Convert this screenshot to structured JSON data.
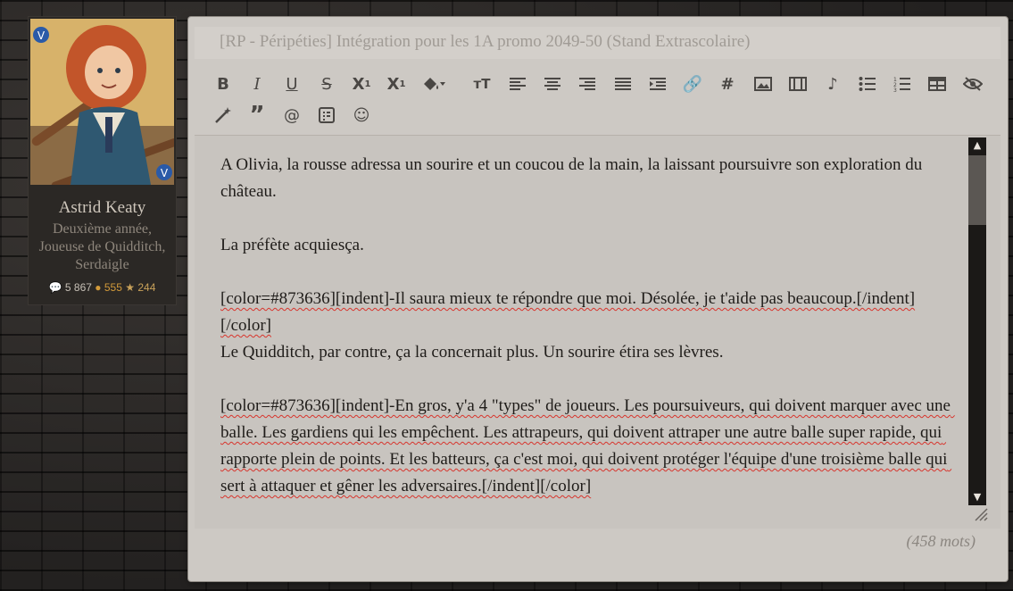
{
  "profile": {
    "name": "Astrid Keaty",
    "role": "Deuxième année, Joueuse de Quidditch, Serdaigle",
    "messages_count": "5 867",
    "gold_count": "555",
    "stars_count": "244",
    "avatar_icon": "character-portrait"
  },
  "editor": {
    "subject": "[RP - Péripéties] Intégration pour les 1A promo 2049-50 (Stand Extrascolaire)",
    "toolbar_row1": [
      "bold-icon",
      "italic-icon",
      "underline-icon",
      "strikethrough-icon",
      "subscript-icon",
      "superscript-icon",
      "fill-color-icon",
      "font-size-icon",
      "align-left-icon",
      "align-center-icon",
      "align-right-icon",
      "align-justify-icon",
      "indent-icon",
      "link-icon",
      "hashtag-icon",
      "image-icon",
      "video-icon",
      "music-icon",
      "bullet-list-icon",
      "numbered-list-icon",
      "table-icon",
      "hide-icon"
    ],
    "toolbar_row2": [
      "magic-wand-icon",
      "quote-icon",
      "mention-icon",
      "spoiler-icon",
      "emoji-icon"
    ],
    "text": {
      "p1": "A Olivia, la rousse adressa un sourire et un coucou de la main, la laissant poursuivre son exploration du château.",
      "p2": "La préfète acquiesça.",
      "p3a": "[color=#873636][indent]-Il saura mieux te répondre que moi. Désolée, je t'aide pas beaucoup.[/indent][/color]",
      "p3b": "Le Quidditch, par contre, ça la concernait plus. Un sourire étira ses lèvres.",
      "p4": "[color=#873636][indent]-En gros, y'a 4 \"types\" de joueurs. Les poursuiveurs, qui doivent marquer avec une balle. Les gardiens qui les empêchent. Les attrapeurs, qui doivent attraper une autre balle super rapide, qui rapporte plein de points. Et les batteurs, ça c'est moi, qui doivent protéger l'équipe d'une troisième balle qui sert à attaquer et gêner les adversaires.[/indent][/color]"
    },
    "word_count": "(458 mots)"
  }
}
